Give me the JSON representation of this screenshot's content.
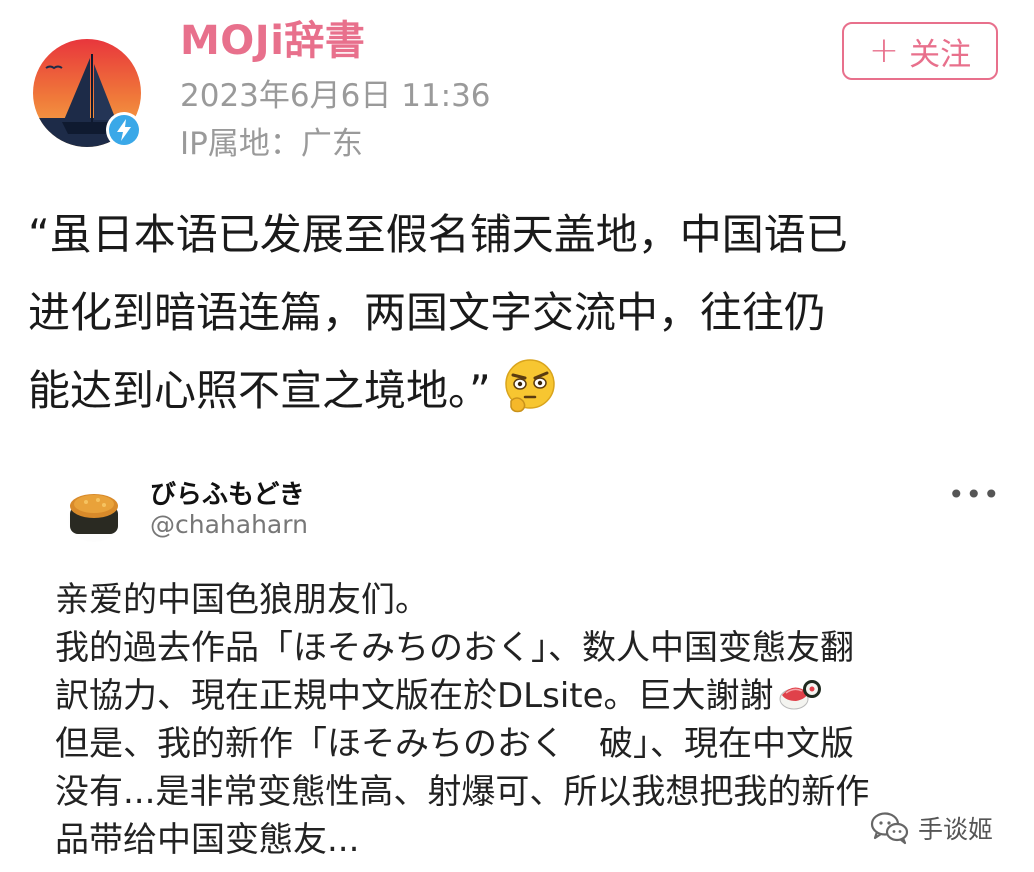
{
  "header": {
    "author_name": "MOJi辞書",
    "post_time": "2023年6月6日 11:36",
    "ip_location": "IP属地：广东",
    "follow_label": "关注",
    "follow_icon": "+"
  },
  "post": {
    "lines": [
      "“虽日本语已发展至假名铺天盖地，中国语已",
      "进化到暗语连篇，两国文字交流中，往往仍",
      "能达到心照不宣之境地。”"
    ],
    "emoji": "thinking-stare-emoji"
  },
  "quoted_tweet": {
    "display_name": "びらふもどき",
    "handle": "@chahaharn",
    "more_label": "•••",
    "lines": [
      "亲爱的中国色狼朋友们。",
      "我的過去作品「ほそみちのおく」、数人中国变態友翻",
      "訳協力、現在正規中文版在於DLsite。巨大謝謝",
      "但是、我的新作「ほそみちのおく　破」、現在中文版",
      "没有...是非常变態性高、射爆可、所以我想把我的新作",
      "品带给中国变態友..."
    ],
    "inline_emoji": "sushi-emoji"
  },
  "watermark": {
    "text": "手谈姬",
    "icon": "wechat-icon"
  },
  "colors": {
    "accent": "#e8708c",
    "muted": "#9a9a9a",
    "verified": "#3aa8e8"
  }
}
